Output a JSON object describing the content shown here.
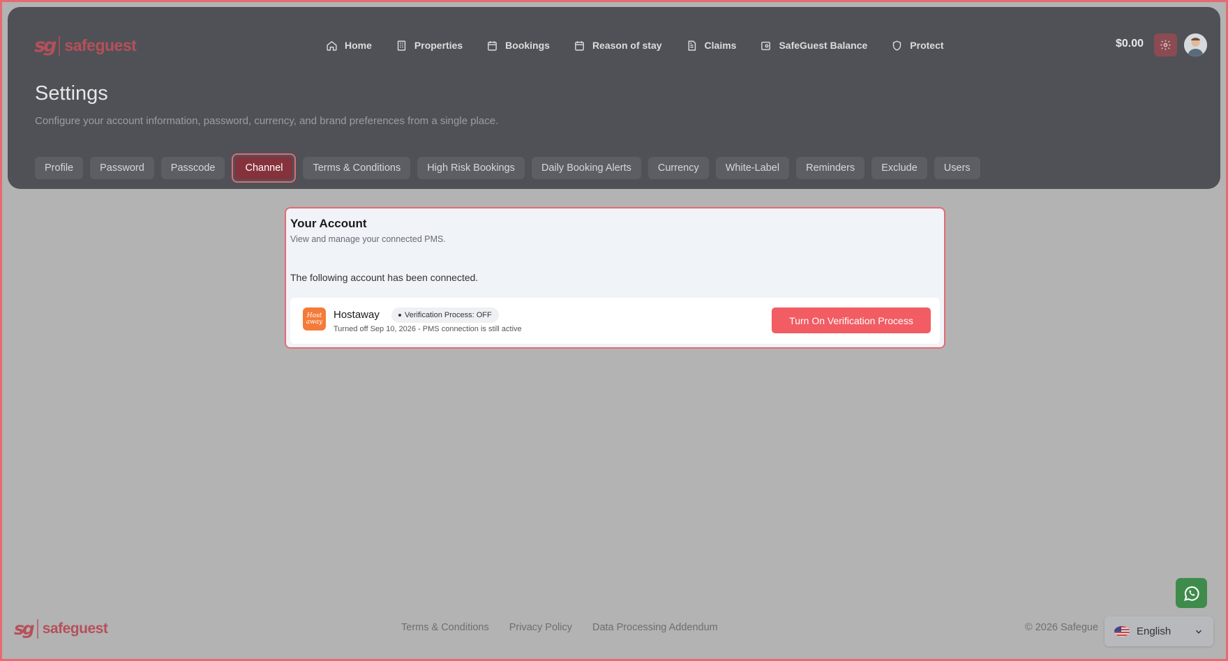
{
  "brand": {
    "mark": "sg",
    "name": "safeguest",
    "color": "#b5505a"
  },
  "nav": {
    "items": [
      {
        "label": "Home",
        "icon": "home-icon"
      },
      {
        "label": "Properties",
        "icon": "building-icon"
      },
      {
        "label": "Bookings",
        "icon": "calendar-icon"
      },
      {
        "label": "Reason of stay",
        "icon": "calendar-icon"
      },
      {
        "label": "Claims",
        "icon": "document-icon"
      },
      {
        "label": "SafeGuest Balance",
        "icon": "wallet-icon"
      },
      {
        "label": "Protect",
        "icon": "shield-icon"
      }
    ]
  },
  "account": {
    "balance": "$0.00"
  },
  "page": {
    "title": "Settings",
    "subtitle": "Configure your account information, password, currency, and brand preferences from a single place."
  },
  "tabs": [
    {
      "label": "Profile",
      "active": false
    },
    {
      "label": "Password",
      "active": false
    },
    {
      "label": "Passcode",
      "active": false
    },
    {
      "label": "Channel",
      "active": true
    },
    {
      "label": "Terms & Conditions",
      "active": false
    },
    {
      "label": "High Risk Bookings",
      "active": false
    },
    {
      "label": "Daily Booking Alerts",
      "active": false
    },
    {
      "label": "Currency",
      "active": false
    },
    {
      "label": "White-Label",
      "active": false
    },
    {
      "label": "Reminders",
      "active": false
    },
    {
      "label": "Exclude",
      "active": false
    },
    {
      "label": "Users",
      "active": false
    }
  ],
  "card": {
    "title": "Your Account",
    "subtitle": "View and manage your connected PMS.",
    "note": "The following account has been connected.",
    "pms": {
      "logo_text_1": "Host",
      "logo_text_2": "away",
      "name": "Hostaway",
      "badge": "Verification Process: OFF",
      "meta": "Turned off Sep 10, 2026 - PMS connection is still active",
      "button_label": "Turn On Verification Process"
    }
  },
  "footer": {
    "links": [
      "Terms & Conditions",
      "Privacy Policy",
      "Data Processing Addendum"
    ],
    "copyright": "© 2026 Safegue",
    "language": "English"
  },
  "colors": {
    "accent": "#f25c63",
    "active_tab": "#86323c",
    "header_bg": "#505156",
    "highlight_border": "#e56a72"
  }
}
